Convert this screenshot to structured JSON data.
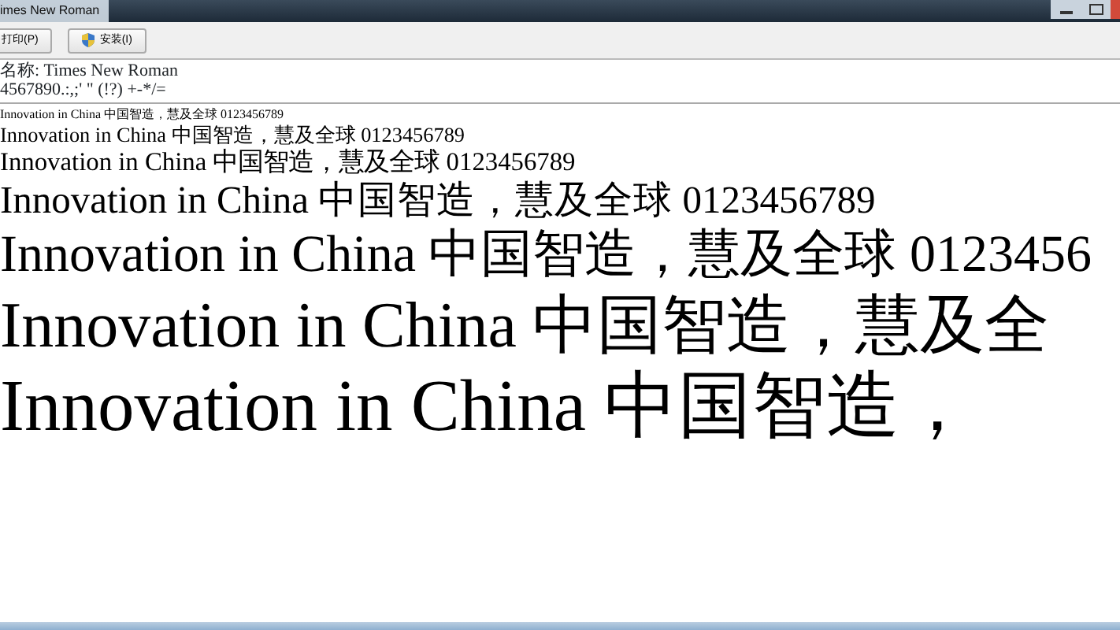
{
  "window": {
    "title": "imes New Roman"
  },
  "toolbar": {
    "buttons": [
      {
        "label": "打印(P)",
        "kind": "plain"
      },
      {
        "label": "安装(I)",
        "kind": "shield"
      }
    ]
  },
  "info": {
    "font_name": "名称: Times New Roman",
    "characters": "4567890.:,;' \" (!?) +-*/="
  },
  "samples": [
    {
      "text": "Innovation in China 中国智造，慧及全球 0123456789"
    },
    {
      "text": "Innovation in China 中国智造，慧及全球 0123456789"
    },
    {
      "text": "Innovation in China 中国智造，慧及全球 0123456789"
    },
    {
      "text": "Innovation in China 中国智造，慧及全球 0123456789"
    },
    {
      "text": "Innovation in China 中国智造，慧及全球 0123456"
    },
    {
      "text": "Innovation in China 中国智造，慧及全"
    },
    {
      "text": "Innovation in China 中国智造，"
    }
  ]
}
